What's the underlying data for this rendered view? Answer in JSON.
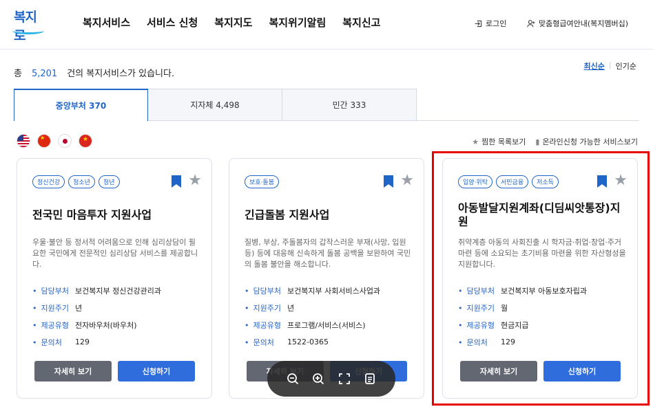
{
  "header": {
    "logo_text": "복지로",
    "nav": [
      "복지서비스",
      "서비스 신청",
      "복지지도",
      "복지위기알림",
      "복지신고"
    ],
    "login": "로그인",
    "member": "맞춤형급여안내(복지멤버십)"
  },
  "summary": {
    "prefix": "총",
    "count": "5,201",
    "suffix": "건의 복지서비스가 있습니다."
  },
  "sort": {
    "latest": "최신순",
    "popular": "인기순"
  },
  "tabs": [
    "중앙부처 370",
    "지자체 4,498",
    "민간 333"
  ],
  "flags": [
    "us-flag-icon",
    "cn-flag-icon",
    "jp-flag-icon",
    "vn-flag-icon"
  ],
  "filters": {
    "favorites": "찜한 목록보기",
    "online": "온라인신청 가능한 서비스보기"
  },
  "info_labels": {
    "dept": "담당부처",
    "cycle": "지원주기",
    "type": "제공유형",
    "contact": "문의처"
  },
  "buttons": {
    "detail": "자세히 보기",
    "apply": "신청하기"
  },
  "cards": [
    {
      "tags": [
        "정신건강",
        "청소년",
        "청년"
      ],
      "title": "전국민 마음투자 지원사업",
      "desc": "우울·불안 등 정서적 어려움으로 인해 심리상담이 필요한 국민에게 전문적인 심리상담 서비스를 제공합니다.",
      "dept": "보건복지부 정신건강관리과",
      "cycle": "년",
      "type": "전자바우처(바우처)",
      "contact": "129"
    },
    {
      "tags": [
        "보호·돌봄"
      ],
      "title": "긴급돌봄 지원사업",
      "desc": "질병, 부상, 주돌봄자의 갑작스러운 부재(사망, 입원 등) 등에 대응해 신속하게 돌봄 공백을 보완하여 국민의 돌봄 불안을 해소합니다.",
      "dept": "보건복지부 사회서비스사업과",
      "cycle": "년",
      "type": "프로그램/서비스(서비스)",
      "contact": "1522-0365"
    },
    {
      "tags": [
        "입양·위탁",
        "서민금융",
        "저소득"
      ],
      "title": "아동발달지원계좌(디딤씨앗통장)지원",
      "desc": "취약계층 아동의 사회진출 시 학자금·취업·창업·주거마련 등에 소요되는 초기비용 마련을 위한 자산형성을 지원합니다.",
      "dept": "보건복지부 아동보호자립과",
      "cycle": "월",
      "type": "현금지급",
      "contact": "129"
    }
  ]
}
